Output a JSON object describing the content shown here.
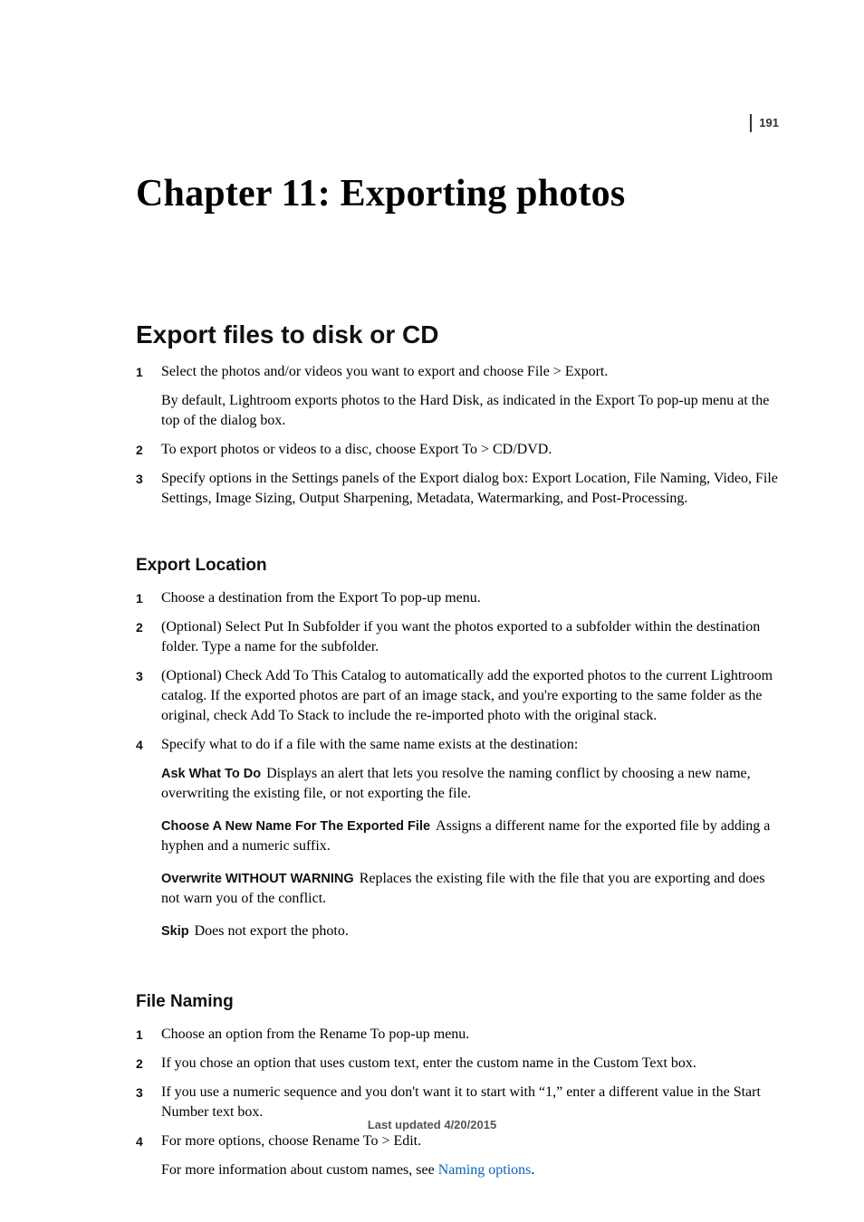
{
  "pageNumber": "191",
  "chapterTitle": "Chapter 11: Exporting photos",
  "section": {
    "title": "Export files to disk or CD",
    "steps": [
      {
        "num": "1",
        "paras": [
          "Select the photos and/or videos you want to export and choose File > Export.",
          "By default, Lightroom exports photos to the Hard Disk, as indicated in the Export To pop-up menu at the top of the dialog box."
        ]
      },
      {
        "num": "2",
        "paras": [
          "To export photos or videos to a disc, choose Export To > CD/DVD."
        ]
      },
      {
        "num": "3",
        "paras": [
          "Specify options in the Settings panels of the Export dialog box: Export Location, File Naming, Video, File Settings, Image Sizing, Output Sharpening, Metadata, Watermarking, and Post-Processing."
        ]
      }
    ]
  },
  "exportLocation": {
    "title": "Export Location",
    "steps": [
      {
        "num": "1",
        "paras": [
          "Choose a destination from the Export To pop-up menu."
        ]
      },
      {
        "num": "2",
        "paras": [
          "(Optional) Select Put In Subfolder if you want the photos exported to a subfolder within the destination folder. Type a name for the subfolder."
        ]
      },
      {
        "num": "3",
        "paras": [
          "(Optional) Check Add To This Catalog to automatically add the exported photos to the current Lightroom catalog. If the exported photos are part of an image stack, and you're exporting to the same folder as the original, check Add To Stack to include the re-imported photo with the original stack."
        ]
      },
      {
        "num": "4",
        "paras": [
          "Specify what to do if a file with the same name exists at the destination:"
        ]
      }
    ],
    "defs": [
      {
        "term": "Ask What To Do",
        "desc": "Displays an alert that lets you resolve the naming conflict by choosing a new name, overwriting the existing file, or not exporting the file."
      },
      {
        "term": "Choose A New Name For The Exported File",
        "desc": "Assigns a different name for the exported file by adding a hyphen and a numeric suffix."
      },
      {
        "term": "Overwrite WITHOUT WARNING",
        "desc": "Replaces the existing file with the file that you are exporting and does not warn you of the conflict."
      },
      {
        "term": "Skip",
        "desc": "Does not export the photo."
      }
    ]
  },
  "fileNaming": {
    "title": "File Naming",
    "steps": [
      {
        "num": "1",
        "paras": [
          "Choose an option from the Rename To pop-up menu."
        ]
      },
      {
        "num": "2",
        "paras": [
          "If you chose an option that uses custom text, enter the custom name in the Custom Text box."
        ]
      },
      {
        "num": "3",
        "paras": [
          "If you use a numeric sequence and you don't want it to start with “1,” enter a different value in the Start Number text box."
        ]
      },
      {
        "num": "4",
        "paras": [
          "For more options, choose Rename To > Edit."
        ],
        "tail_pre": "For more information about custom names, see ",
        "tail_link": "Naming options",
        "tail_post": "."
      }
    ]
  },
  "footer": "Last updated 4/20/2015"
}
